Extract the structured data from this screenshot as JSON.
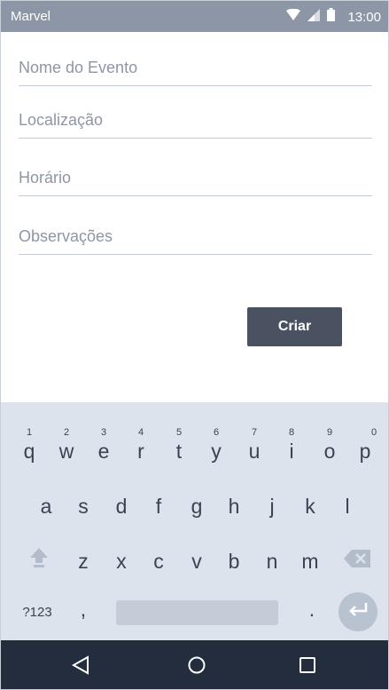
{
  "status_bar": {
    "carrier": "Marvel",
    "time": "13:00"
  },
  "form": {
    "fields": [
      {
        "label": "Nome do Evento"
      },
      {
        "label": "Localização"
      },
      {
        "label": "Horário"
      },
      {
        "label": "Observações"
      }
    ],
    "submit_label": "Criar"
  },
  "keyboard": {
    "row1": [
      {
        "key": "q",
        "hint": "1"
      },
      {
        "key": "w",
        "hint": "2"
      },
      {
        "key": "e",
        "hint": "3"
      },
      {
        "key": "r",
        "hint": "4"
      },
      {
        "key": "t",
        "hint": "5"
      },
      {
        "key": "y",
        "hint": "6"
      },
      {
        "key": "u",
        "hint": "7"
      },
      {
        "key": "i",
        "hint": "8"
      },
      {
        "key": "o",
        "hint": "9"
      },
      {
        "key": "p",
        "hint": "0"
      }
    ],
    "row2": [
      "a",
      "s",
      "d",
      "f",
      "g",
      "h",
      "j",
      "k",
      "l"
    ],
    "row3": [
      "z",
      "x",
      "c",
      "v",
      "b",
      "n",
      "m"
    ],
    "symbols_key": "?123",
    "comma_key": ",",
    "period_key": "."
  },
  "colors": {
    "status_bar": "#8d96a6",
    "accent_button": "#4a5160",
    "nav_bar": "#232d3d",
    "keyboard_bg": "#dde3ec"
  }
}
